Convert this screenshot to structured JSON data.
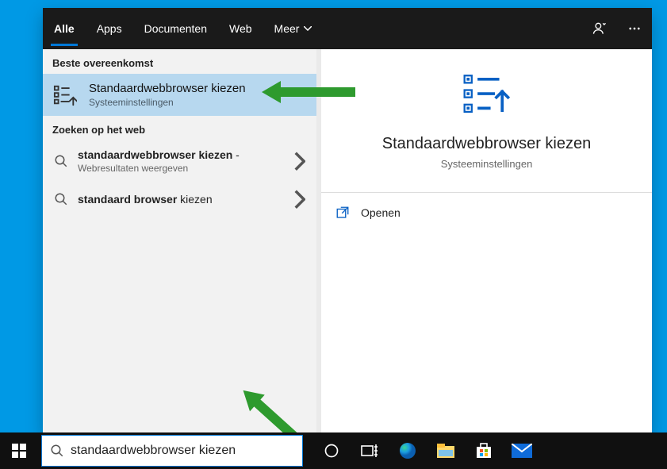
{
  "tabs": {
    "all": "Alle",
    "apps": "Apps",
    "docs": "Documenten",
    "web": "Web",
    "more": "Meer"
  },
  "sections": {
    "best": "Beste overeenkomst",
    "web": "Zoeken op het web"
  },
  "best": {
    "title": "Standaardwebbrowser kiezen",
    "sub": "Systeeminstellingen"
  },
  "webresults": {
    "r1_bold": "standaardwebbrowser kiezen",
    "r1_tail": " - ",
    "r1_sub": "Webresultaten weergeven",
    "r2_bold": "standaard browser",
    "r2_tail": " kiezen"
  },
  "preview": {
    "title": "Standaardwebbrowser kiezen",
    "sub": "Systeeminstellingen",
    "open": "Openen"
  },
  "search": {
    "value": "standaardwebbrowser kiezen"
  }
}
